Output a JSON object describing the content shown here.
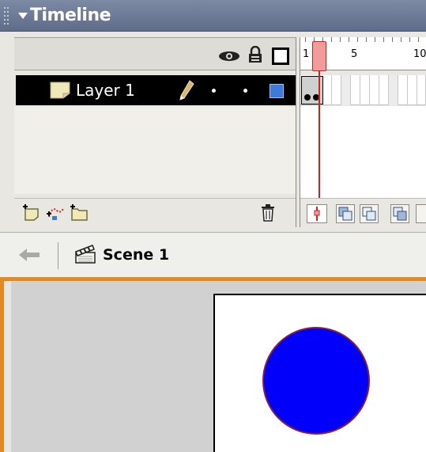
{
  "timeline": {
    "title": "Timeline",
    "layers": [
      {
        "name": "Layer 1",
        "outline_color": "#3d7bdb"
      }
    ],
    "frame_ruler": {
      "labels": [
        "1",
        "5",
        "10"
      ]
    },
    "current_frame": 1,
    "icons": {
      "show_hide_all": "eye-icon",
      "lock_all": "lock-icon",
      "outline_all": "outline-square-icon",
      "insert_layer": "insert-layer-icon",
      "add_motion_guide": "add-motion-guide-icon",
      "insert_folder": "insert-folder-icon",
      "delete_layer": "trash-icon",
      "edit_layer": "pencil-icon"
    }
  },
  "edit_bar": {
    "scene_label": "Scene 1"
  },
  "stage": {
    "circle_fill": "#0000fb",
    "circle_stroke": "#8b1d3a",
    "work_area_color": "#d1d1d1",
    "focus_border_color": "#e58a1e"
  }
}
